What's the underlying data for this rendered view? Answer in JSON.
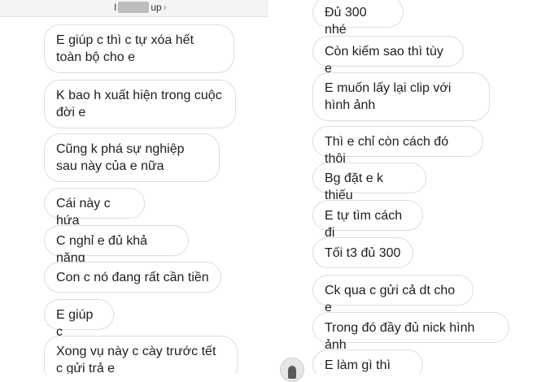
{
  "left": {
    "header": {
      "title_prefix": "I",
      "title_suffix": "up",
      "chevron": "›"
    },
    "messages": [
      "E giúp c thì c tự xóa hết toàn bộ cho e",
      "K bao h xuất hiện trong cuộc đời e",
      "Cũng k phá sự nghiệp sau này của e nữa",
      "Cái này c hứa",
      "C nghỉ e đủ khả năng",
      "Con c nó đang rất cần tiền",
      "E giúp c",
      "Xong vụ này c cày trước tết c gửi trả e"
    ]
  },
  "right": {
    "messages": [
      "Đủ 300 nhé",
      "Còn kiếm sao thì tùy e",
      "E muốn lấy lại clip với hình ảnh",
      "Thì e chỉ còn cách đó thôi",
      "Bg đặt e k thiếu",
      "E tự tìm cách đi",
      "Tối t3 đủ 300",
      "Ck qua c gửi cả dt cho e",
      "Trong đó đầy đủ nick hình ảnh",
      "E làm gì thì làm"
    ],
    "avatar_icon": "user-avatar-icon"
  },
  "colors": {
    "bubble_border": "#dcdcdc",
    "bubble_bg": "#ffffff",
    "text": "#1e1e1e"
  }
}
